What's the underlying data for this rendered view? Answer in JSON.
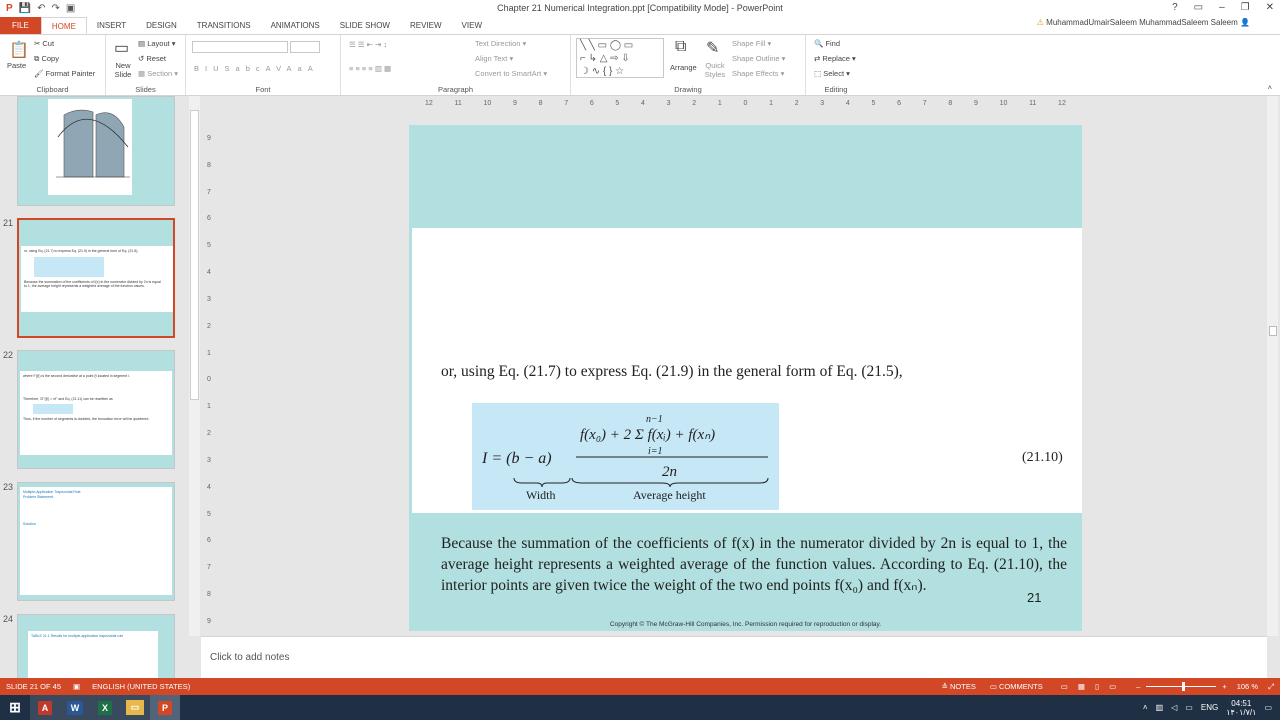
{
  "window": {
    "title": "Chapter 21 Numerical Integration.ppt [Compatibility Mode] - PowerPoint",
    "controls": [
      "?",
      "▭",
      "–",
      "❐",
      "✕"
    ]
  },
  "tabs": [
    "FILE",
    "HOME",
    "INSERT",
    "DESIGN",
    "TRANSITIONS",
    "ANIMATIONS",
    "SLIDE SHOW",
    "REVIEW",
    "VIEW"
  ],
  "user": "MuhammadUmairSaleem MuhammadSaleem Saleem",
  "ribbon": {
    "clipboard": {
      "label": "Clipboard",
      "paste": "Paste",
      "cut": "Cut",
      "copy": "Copy",
      "format_painter": "Format Painter"
    },
    "slides": {
      "label": "Slides",
      "new_slide": "New Slide",
      "layout": "Layout",
      "reset": "Reset",
      "section": "Section"
    },
    "font": {
      "label": "Font",
      "b": "B",
      "i": "I",
      "u": "U",
      "s": "S",
      "abc": "abc",
      "av": "AV",
      "aa": "Aa",
      "a": "A"
    },
    "paragraph": {
      "label": "Paragraph",
      "text_direction": "Text Direction",
      "align_text": "Align Text",
      "convert": "Convert to SmartArt"
    },
    "drawing": {
      "label": "Drawing",
      "arrange": "Arrange",
      "quick_styles": "Quick Styles",
      "shape_fill": "Shape Fill",
      "shape_outline": "Shape Outline",
      "shape_effects": "Shape Effects"
    },
    "editing": {
      "label": "Editing",
      "find": "Find",
      "replace": "Replace",
      "select": "Select"
    }
  },
  "thumbnails": [
    {
      "num": "",
      "lines": []
    },
    {
      "num": "21",
      "lines": [
        "or, using Eq. (21.7) to express Eq. (21.9) in the general form of Eq. (21.5),",
        "Because the summation of the coefficients of f(x) in the numerator divided by 2n is equal",
        "to 1, the average height represents a weighted average of the function values."
      ]
    },
    {
      "num": "22",
      "lines": [
        "where f''(ξi) is the second derivative at a point ξi located in segment i.",
        "Therefore, Σf''(ξi) ≈ nf'' and Eq. (21.11) can be rewritten as",
        "Thus, if the number of segments is doubled, the truncation error will be quartered."
      ]
    },
    {
      "num": "23",
      "lines": [
        "Multiple-Application Trapezoidal Rule",
        "Problem Statement.",
        "Solution."
      ]
    },
    {
      "num": "24",
      "lines": [
        "TABLE 21.1 Results for multiple-application trapezoidal rule"
      ]
    }
  ],
  "ruler": {
    "h": [
      "12",
      "11",
      "10",
      "9",
      "8",
      "7",
      "6",
      "5",
      "4",
      "3",
      "2",
      "1",
      "0",
      "1",
      "2",
      "3",
      "4",
      "5",
      "6",
      "7",
      "8",
      "9",
      "10",
      "11",
      "12"
    ],
    "v": [
      "9",
      "8",
      "7",
      "6",
      "5",
      "4",
      "3",
      "2",
      "1",
      "0",
      "1",
      "2",
      "3",
      "4",
      "5",
      "6",
      "7",
      "8",
      "9"
    ]
  },
  "slide": {
    "intro": "or, using Eq. (21.7) to express Eq. (21.9) in the general form of Eq. (21.5),",
    "equation": {
      "lhs": "I = (b − a)",
      "numerator": "f(x₀) + 2 Σ f(xᵢ) + f(xₙ)",
      "sum_upper": "n−1",
      "sum_lower": "i=1",
      "denominator": "2n",
      "width_label": "Width",
      "avg_label": "Average height",
      "number": "(21.10)"
    },
    "paragraph": "Because the summation of the coefficients of f(x) in the numerator divided by 2n is equal to 1, the average height represents a weighted average of the function values. According to Eq. (21.10), the interior points are given twice the weight of the two end points f(x₀) and f(xₙ).",
    "number": "21",
    "copyright": "Copyright ©  The McGraw-Hill Companies, Inc.  Permission required for reproduction or display."
  },
  "notes": {
    "placeholder": "Click to add notes"
  },
  "status": {
    "slide": "SLIDE 21 OF 45",
    "lang": "ENGLISH (UNITED STATES)",
    "notes": "NOTES",
    "comments": "COMMENTS",
    "zoom": "106 %"
  },
  "taskbar": {
    "lang": "ENG",
    "time": "04:51",
    "date": "۱۴۰۱/۷/۱"
  },
  "colors": {
    "accent": "#d24726",
    "slide_bg": "#b2dfdf",
    "eq_bg": "#c6e7f5"
  }
}
